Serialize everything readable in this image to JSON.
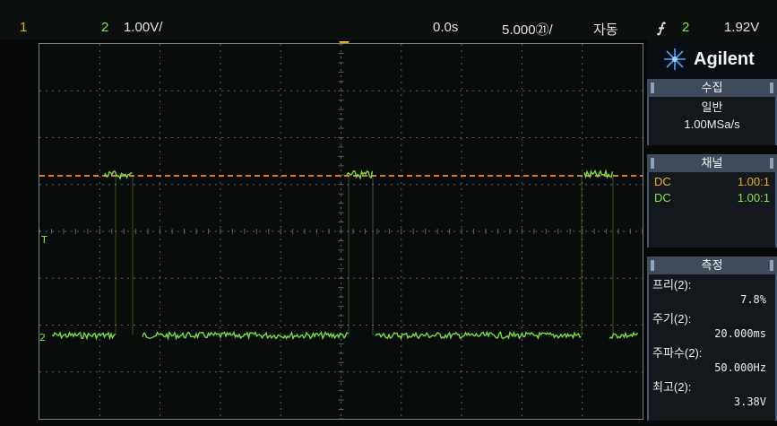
{
  "top_bar": {
    "ch1_label": "1",
    "ch2_label": "2",
    "scale": "1.00V/",
    "delay": "0.0s",
    "time_div": "5.000㉑/",
    "mode": "자동",
    "trigger_channel": "2",
    "trigger_level": "1.92V"
  },
  "screen": {
    "ch1_marker": "T",
    "ch2_marker": "2"
  },
  "brand": {
    "name": "Agilent"
  },
  "acquisition": {
    "header": "수집",
    "mode": "일반",
    "rate": "1.00MSa/s"
  },
  "channels": {
    "header": "채널",
    "items": [
      {
        "coupling": "DC",
        "probe": "1.00:1",
        "color": "#e6b419"
      },
      {
        "coupling": "DC",
        "probe": "1.00:1",
        "color": "#82e84a"
      }
    ]
  },
  "measure": {
    "header": "측정",
    "items": [
      {
        "label": "프리(2):",
        "value": "7.8%"
      },
      {
        "label": "주기(2):",
        "value": "20.000ms"
      },
      {
        "label": "주파수(2):",
        "value": "50.000Hz"
      },
      {
        "label": "최고(2):",
        "value": "3.38V"
      }
    ]
  },
  "colors": {
    "ch1": "#e6b419",
    "ch2": "#82e84a",
    "ch1_trace": "#e07a26",
    "grid": "#5c6360"
  }
}
